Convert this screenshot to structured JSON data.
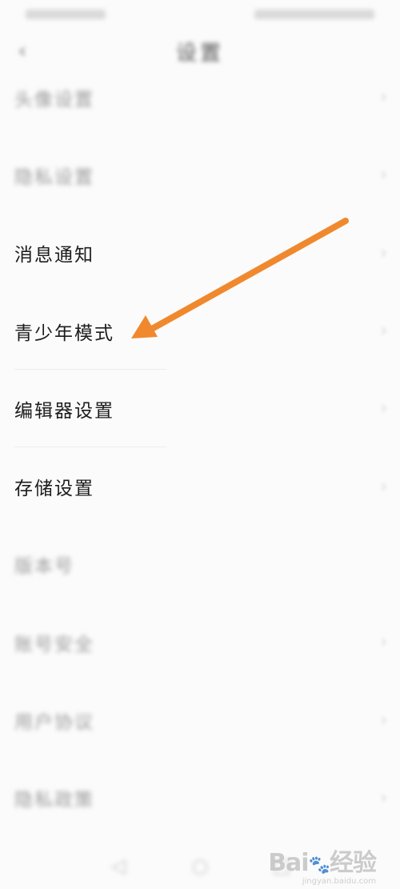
{
  "header": {
    "title": "设置",
    "back_icon": "chevron-left-icon"
  },
  "settings": {
    "items": [
      {
        "label": "头像设置",
        "blurred": true,
        "value": ""
      },
      {
        "label": "隐私设置",
        "blurred": true,
        "value": ""
      },
      {
        "label": "消息通知",
        "blurred": false,
        "value": ""
      },
      {
        "label": "青少年模式",
        "blurred": false,
        "value": ""
      },
      {
        "label": "编辑器设置",
        "blurred": false,
        "value": ""
      },
      {
        "label": "存储设置",
        "blurred": false,
        "value": ""
      },
      {
        "label": "版本号",
        "blurred": true,
        "value": ""
      },
      {
        "label": "账号安全",
        "blurred": true,
        "value": ""
      },
      {
        "label": "用户协议",
        "blurred": true,
        "value": ""
      },
      {
        "label": "隐私政策",
        "blurred": true,
        "value": ""
      }
    ]
  },
  "annotation": {
    "arrow_color": "#f0892e",
    "target": "青少年模式"
  },
  "watermark": {
    "brand": "Bai",
    "logo_icon": "paw-icon",
    "suffix": "经验",
    "url": "jingyan.baidu.com"
  }
}
